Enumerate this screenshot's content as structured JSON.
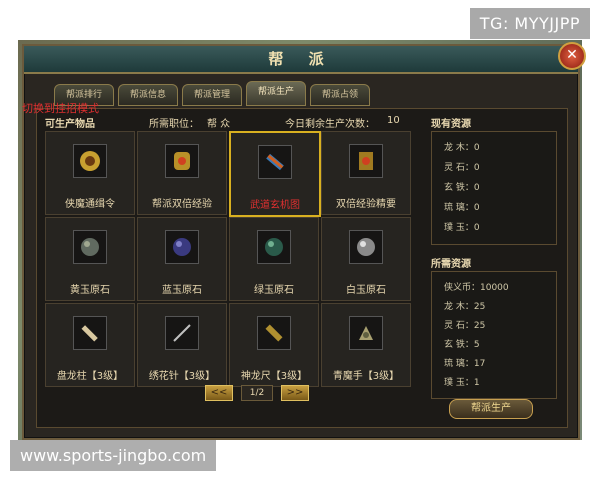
{
  "watermarks": {
    "top": "TG: MYYJJPP",
    "bottom": "www.sports-jingbo.com"
  },
  "mode_text": "切换到挂招模式",
  "window": {
    "title": "帮 派",
    "close_icon": "✕"
  },
  "tabs": [
    {
      "label": "帮派排行",
      "active": false
    },
    {
      "label": "帮派信息",
      "active": false
    },
    {
      "label": "帮派管理",
      "active": false
    },
    {
      "label": "帮派生产",
      "active": true
    },
    {
      "label": "帮派占领",
      "active": false
    }
  ],
  "header": {
    "producible_label": "可生产物品",
    "position_label": "所需职位：",
    "position_value": "帮 众",
    "remaining_label": "今日剩余生产次数：",
    "remaining_value": "10"
  },
  "items": [
    {
      "label": "侠魔通缉令",
      "icon": "seal-icon",
      "selected": false
    },
    {
      "label": "帮派双倍经验",
      "icon": "scroll-icon",
      "selected": false
    },
    {
      "label": "武道玄机图",
      "icon": "map-scroll-icon",
      "selected": true
    },
    {
      "label": "双倍经验精要",
      "icon": "book-icon",
      "selected": false
    },
    {
      "label": "黄玉原石",
      "icon": "ore-icon",
      "selected": false
    },
    {
      "label": "蓝玉原石",
      "icon": "ore-icon",
      "selected": false
    },
    {
      "label": "绿玉原石",
      "icon": "ore-icon",
      "selected": false
    },
    {
      "label": "白玉原石",
      "icon": "ore-icon",
      "selected": false
    },
    {
      "label": "盘龙柱【3级】",
      "icon": "pillar-icon",
      "selected": false
    },
    {
      "label": "绣花针【3级】",
      "icon": "needle-icon",
      "selected": false
    },
    {
      "label": "神龙尺【3级】",
      "icon": "ruler-icon",
      "selected": false
    },
    {
      "label": "青魔手【3级】",
      "icon": "claw-icon",
      "selected": false
    }
  ],
  "pager": {
    "prev": "<<",
    "next": ">>",
    "page": "1/2"
  },
  "current_resources": {
    "title": "现有资源",
    "lines": [
      "龙 木：0",
      "灵 石：0",
      "玄 铁：0",
      "琉 璃：0",
      "璞 玉：0"
    ]
  },
  "required_resources": {
    "title": "所需资源",
    "lines": [
      "侠义币：10000",
      "龙 木：25",
      "灵 石：25",
      "玄 铁：5",
      "琉 璃：17",
      "璞 玉：1"
    ]
  },
  "produce_button": "帮派生产",
  "colors": {
    "selected_border": "#d8b020",
    "selected_text": "#e03030",
    "gold_text": "#e8d8b0"
  }
}
